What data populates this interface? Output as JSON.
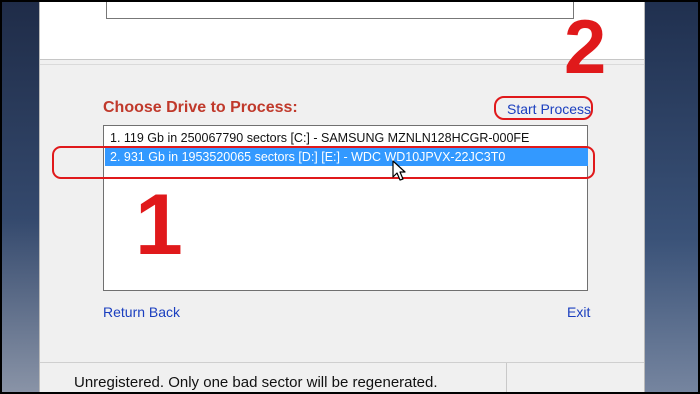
{
  "panel": {
    "heading": "Choose Drive to Process:",
    "start_label": "Start Process",
    "return_label": "Return Back",
    "exit_label": "Exit"
  },
  "drives": [
    {
      "label": "1. 119 Gb in 250067790 sectors [C:]  -  SAMSUNG MZNLN128HCGR-000FE",
      "selected": false
    },
    {
      "label": "2. 931 Gb in 1953520065 sectors [D:] [E:]  -  WDC WD10JPVX-22JC3T0",
      "selected": true
    }
  ],
  "status": {
    "text": "Unregistered. Only one bad sector will be regenerated."
  },
  "annotations": {
    "step1": "1",
    "step2": "2",
    "color": "#e0191b"
  },
  "colors": {
    "heading": "#c0392b",
    "link": "#1b3fbf",
    "selection": "#3399ff"
  }
}
